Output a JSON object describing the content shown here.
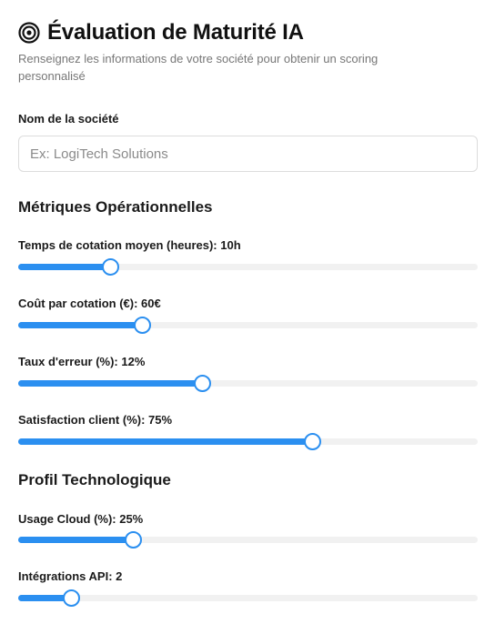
{
  "header": {
    "icon": "target-icon",
    "title": "Évaluation de Maturité IA",
    "subtitle": "Renseignez les informations de votre société pour obtenir un scoring personnalisé"
  },
  "company": {
    "label": "Nom de la société",
    "placeholder": "Ex: LogiTech Solutions",
    "value": ""
  },
  "operational": {
    "title": "Métriques Opérationnelles",
    "sliders": [
      {
        "label": "Temps de cotation moyen (heures): 10h",
        "fraction": 0.2
      },
      {
        "label": "Coût par cotation (€): 60€",
        "fraction": 0.27
      },
      {
        "label": "Taux d'erreur (%): 12%",
        "fraction": 0.4
      },
      {
        "label": "Satisfaction client (%): 75%",
        "fraction": 0.64
      }
    ]
  },
  "tech": {
    "title": "Profil Technologique",
    "sliders": [
      {
        "label": "Usage Cloud (%): 25%",
        "fraction": 0.25
      },
      {
        "label": "Intégrations API: 2",
        "fraction": 0.115
      }
    ]
  },
  "colors": {
    "accent": "#2b8ff0",
    "track": "#f1f1f1",
    "muted_text": "#777777"
  }
}
